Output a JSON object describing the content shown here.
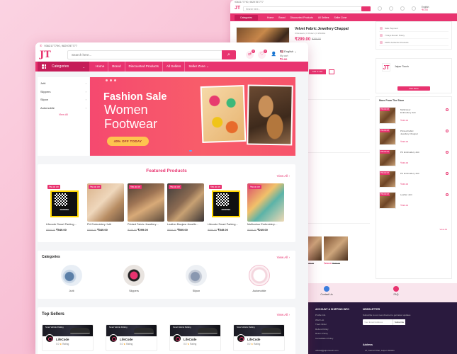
{
  "colors": {
    "brand": "#e8336f",
    "brand_dark": "#c51c58",
    "cta_yellow": "#fec44f",
    "background": "#f8bfd4"
  },
  "front": {
    "contact": "9362177790, 9829787777",
    "search": {
      "placeholder": "Search here..."
    },
    "language": "English",
    "cart": {
      "label": "My cart",
      "amount": "₹0.00",
      "badge": "0"
    },
    "wishlist_badge": "0",
    "compare_badge": "0",
    "nav": {
      "categories_label": "Categories",
      "items": [
        "Home",
        "Brand",
        "Discounted Products",
        "All Sellers",
        "Seller Zone"
      ],
      "seller_zone_chevron": "⌄"
    },
    "side_categories": {
      "items": [
        "Jutti",
        "Slippers",
        "Slipon",
        "Automobile"
      ],
      "view_all": "View All"
    },
    "banner": {
      "line1": "Fashion Sale",
      "line2": "Women",
      "line3": "Footwear",
      "cta": "40% OFF TODAY"
    },
    "featured": {
      "title": "Featured Products",
      "view_all": "View All",
      "products": [
        {
          "off": "₹50.00 Off",
          "name": "Lifecode Smart Parking…",
          "old": "₹599.00",
          "price": "₹549.00",
          "img": "parking"
        },
        {
          "off": "₹50.00 Off",
          "name": "PU Embroidery Jutti",
          "old": "₹399.00",
          "price": "₹349.00",
          "img": "shoe1"
        },
        {
          "off": "₹50.00 Off",
          "name": "Printed Fabric Jewellery…",
          "old": "₹349.00",
          "price": "₹299.00",
          "img": "shoe2"
        },
        {
          "off": "₹50.00 Off",
          "name": "Leather Banjara Jewelle…",
          "old": "₹559.00",
          "price": "₹509.00",
          "img": "shoe3"
        },
        {
          "off": "₹50.00 Off",
          "name": "Lifecode Smart Parking…",
          "old": "₹599.00",
          "price": "₹549.00",
          "img": "parking"
        },
        {
          "off": "₹50.00 Off",
          "name": "Multicolour Embroidery…",
          "old": "₹299.00",
          "price": "₹249.00",
          "img": "shoe4"
        }
      ]
    },
    "categories": {
      "title": "Categories",
      "view_all": "View All",
      "items": [
        "Jutti",
        "Slippers",
        "Slipon",
        "Automobile"
      ]
    },
    "top_sellers": {
      "title": "Top Sellers",
      "view_all": "View All",
      "sellers": [
        {
          "name": "LifeCode",
          "rating": "0.0",
          "rating_label": "Rating",
          "cover_text": "Smart Vehicle Parking"
        },
        {
          "name": "LifeCode",
          "rating": "0.0",
          "rating_label": "Rating",
          "cover_text": "Smart Vehicle Parking"
        },
        {
          "name": "LifeCode",
          "rating": "0.0",
          "rating_label": "Rating",
          "cover_text": "Smart Vehicle Parking"
        },
        {
          "name": "LifeCode",
          "rating": "0.0",
          "rating_label": "Rating",
          "cover_text": "Smart Vehicle Parking"
        }
      ]
    }
  },
  "back": {
    "contact": "9362177790, 9829787777",
    "search_placeholder": "Search here...",
    "language": "English",
    "cart_amount": "₹0.00",
    "nav": {
      "categories_label": "Categories",
      "items": [
        "Home",
        "Brand",
        "Discounted Products",
        "All Sellers",
        "Seller Zone"
      ]
    },
    "product": {
      "title": "Velvet Fabric Jewellery Chappal",
      "meta": "0 Reviews  |  0 Orders  |  0 Wishlist",
      "price": "₹299.00",
      "old_price": "₹349.00",
      "buy_now": "Add to cart"
    },
    "features": [
      "Safe Payment",
      "7 Days Return Policy",
      "100% Authentic Products"
    ],
    "shop": {
      "name": "Jaipur Touch",
      "visit": "Visit Store"
    },
    "more_from": {
      "title": "More From The Store",
      "items": [
        {
          "off": "₹50.00 Off",
          "name": "Multicolour Embroidery Jutti",
          "price": "₹249.00"
        },
        {
          "off": "₹50.00 Off",
          "name": "Printed Fabric Jewellery Chappal",
          "price": "₹299.00"
        },
        {
          "off": "₹50.00 Off",
          "name": "PU Embroidery Jutti",
          "price": "₹349.00"
        },
        {
          "off": "₹50.00 Off",
          "name": "PU Embroidery Jutti",
          "price": "₹349.00"
        },
        {
          "off": "₹50.00 Off",
          "name": "Leather Jutti",
          "price": "₹399.00"
        }
      ],
      "view_all": "View All"
    },
    "lower_products": [
      {
        "price": "₹299.00",
        "old": "₹349.00"
      },
      {
        "price": "₹299.00",
        "old": "₹349.00"
      }
    ],
    "contact_strip": {
      "contact_us": "Contact Us",
      "faq": "FAQ"
    },
    "footer": {
      "col1_title": "ACCOUNT & SHIPPING INFO",
      "col1_items": [
        "Profile Info",
        "Wish List",
        "Track Order",
        "Refund Policy",
        "Return Policy",
        "Cancellation Policy"
      ],
      "col2_title": "NEWSLETTER",
      "col2_text": "Subscribe to our new channel to get latest updates",
      "newsletter_placeholder": "Your Email Address",
      "newsletter_btn": "Subscribe",
      "address_title": "Address",
      "email": "official@jaipurtouch.com",
      "address_text": "27, Kamal Vihar, Jaipur 302021"
    }
  }
}
